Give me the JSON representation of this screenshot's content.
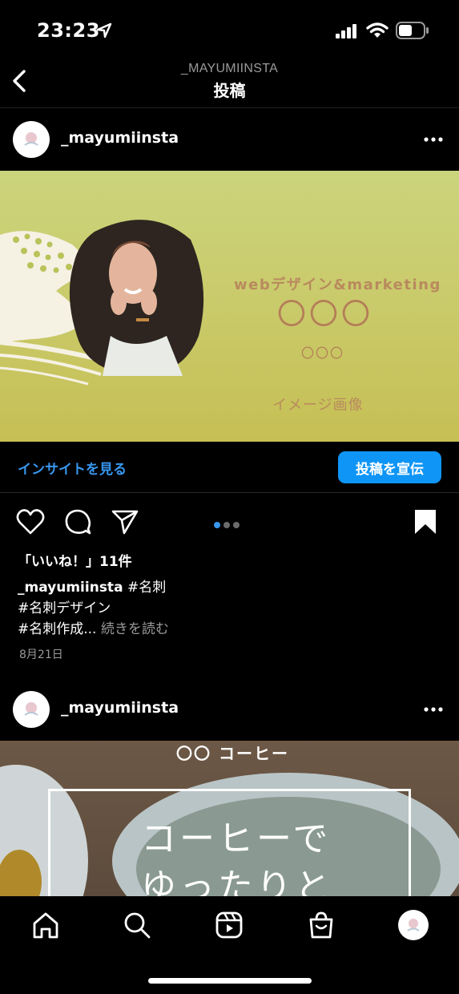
{
  "status_bar": {
    "time": "23:23"
  },
  "nav": {
    "subtitle": "_MAYUMIINSTA",
    "title": "投稿"
  },
  "post1": {
    "username": "_mayumiinsta",
    "image": {
      "subtitle": "webデザイン&marketing",
      "title": "〇〇〇",
      "title_small": "〇〇〇",
      "caption": "イメージ画像"
    },
    "insights_label": "インサイトを見る",
    "promote_label": "投稿を宣伝",
    "likes": "「いいね！」11件",
    "caption_user": "_mayumiinsta",
    "caption_line1": "#名刺",
    "caption_line2": "#名刺デザイン",
    "caption_line3": "#名刺作成...",
    "read_more": "続きを読む",
    "date": "8月21日",
    "carousel": {
      "count": 3,
      "active": 0
    }
  },
  "post2": {
    "username": "_mayumiinsta",
    "image": {
      "top_text": "〇〇 コーヒー",
      "line1": "コーヒーで",
      "line2": "ゆったりと"
    }
  },
  "tabbar": {
    "items": [
      "home-icon",
      "search-icon",
      "reels-icon",
      "shop-icon",
      "profile-avatar"
    ]
  },
  "colors": {
    "link": "#3797f0",
    "button": "#0f95f6",
    "image_bg": "#c9c968",
    "image_text": "#b47d58"
  }
}
